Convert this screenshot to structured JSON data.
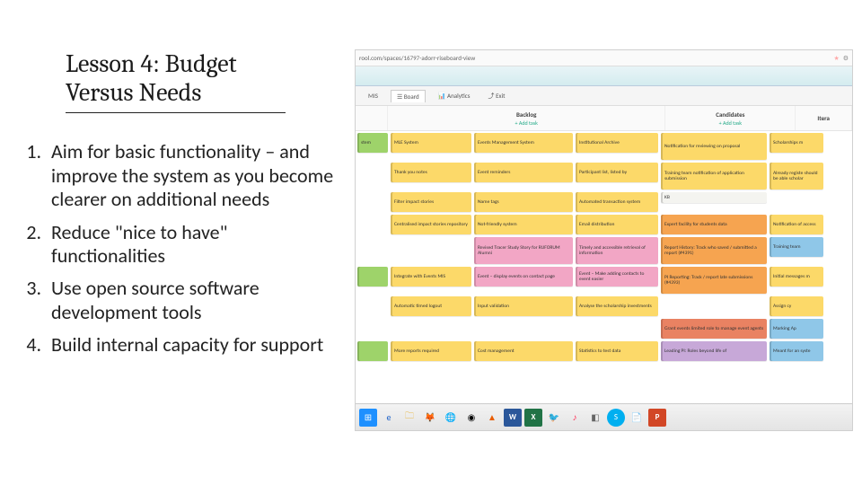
{
  "title_line1": "Lesson 4: Budget",
  "title_line2": "Versus Needs",
  "points": [
    "Aim for basic functionality – and improve the system as you become clearer on additional needs",
    "Reduce \"nice to have\" functionalities",
    "Use open source software development tools",
    "Build internal capacity for support"
  ],
  "screenshot": {
    "url_fragment": "rool.com/spaces/16797-adorr-riseboard-view",
    "tabs": {
      "mis": "MIS",
      "board": "Board",
      "analytics": "Analytics",
      "exit": "Exit"
    },
    "columns": {
      "backlog": "Backlog",
      "candidates": "Candidates",
      "itera": "Itera",
      "add": "+ Add task"
    },
    "cards": {
      "r1": [
        "stem",
        "MLE System",
        "Events Management System",
        "Institutional Archive",
        "Notification for reviewing on proposal",
        "Scholarships m"
      ],
      "r2": [
        "",
        "Thank you notes",
        "Event reminders",
        "Participant list, listed by",
        "Training team notification of application submission",
        "Already registe should be able scholar"
      ],
      "r3": [
        "",
        "Filter impact stories",
        "Name tags",
        "Automated transaction system",
        "KB",
        ""
      ],
      "r4": [
        "",
        "Centralised impact stories repository",
        "Not-friendly system",
        "Email distribution",
        "Expert facility for students data",
        "Notification of access"
      ],
      "r5": [
        "",
        "",
        "Revised Tracer Study Story for RUFORUM Alumni",
        "Timely and accessible retrieval of information",
        "Report History: Track who saved / submitted a report (#4391)",
        "Training team"
      ],
      "r6": [
        "",
        "Integrate with Events MIS",
        "Event – display events on contact page",
        "Event – Make adding contacts to event easier",
        "PI Reporting: Track / report late submissions (#4393)",
        "Initial messages m"
      ],
      "r7": [
        "",
        "Automatic timed logout",
        "Input validation",
        "Analyse the scholarship investments",
        "",
        "Assign cy"
      ],
      "r8": [
        "",
        "",
        "",
        "",
        "Grant events limited role to manage event agents",
        "Marking Ap"
      ],
      "r9": [
        "",
        "More reports required",
        "Cost management",
        "Statistics to test data",
        "Leading PI: Roles beyond life of",
        "Meant for an syste"
      ]
    }
  }
}
